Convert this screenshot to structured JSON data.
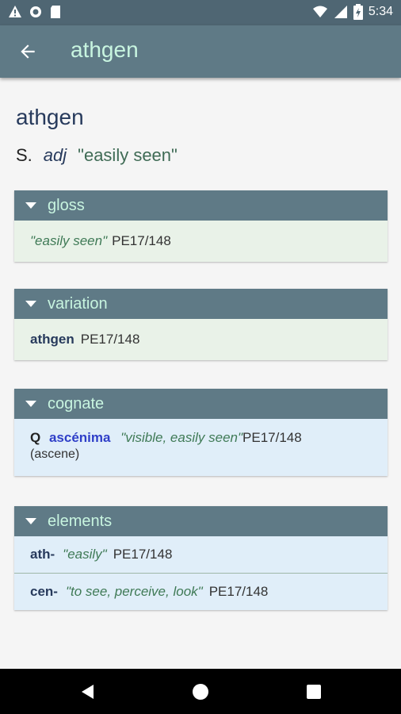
{
  "status": {
    "time": "5:34"
  },
  "appbar": {
    "title": "athgen"
  },
  "entry": {
    "word": "athgen",
    "lang": "S.",
    "pos": "adj",
    "gloss": "\"easily seen\""
  },
  "sections": {
    "gloss": {
      "label": "gloss",
      "text": "\"easily seen\"",
      "ref": "PE17/148"
    },
    "variation": {
      "label": "variation",
      "word": "athgen",
      "ref": "PE17/148"
    },
    "cognate": {
      "label": "cognate",
      "lang": "Q",
      "word": "ascénima",
      "gloss": "\"visible, easily seen\"",
      "ref": "PE17/148",
      "note": "(ascene)"
    },
    "elements": {
      "label": "elements",
      "items": [
        {
          "word": "ath-",
          "gloss": "\"easily\"",
          "ref": "PE17/148"
        },
        {
          "word": "cen-",
          "gloss": "\"to see, perceive, look\"",
          "ref": "PE17/148"
        }
      ]
    }
  }
}
